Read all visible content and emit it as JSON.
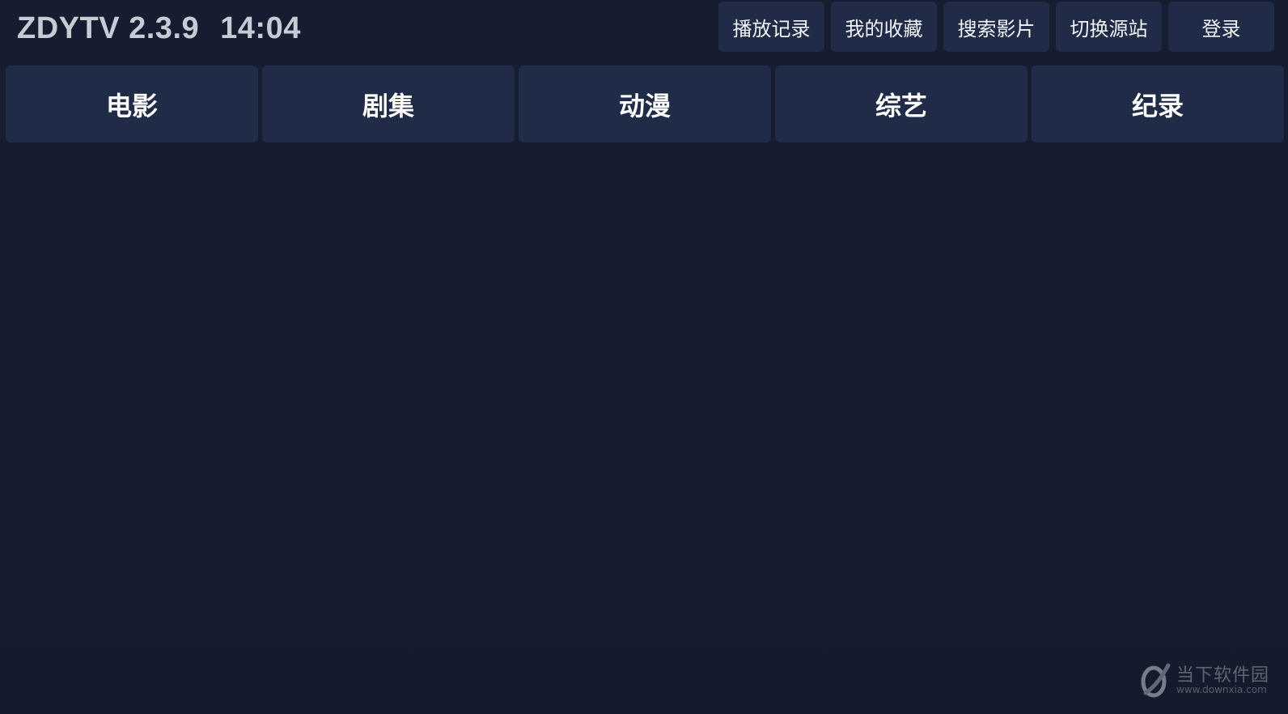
{
  "header": {
    "app_name": "ZDYTV 2.3.9",
    "clock": "14:04"
  },
  "top_actions": [
    {
      "label": "播放记录"
    },
    {
      "label": "我的收藏"
    },
    {
      "label": "搜索影片"
    },
    {
      "label": "切换源站"
    },
    {
      "label": "登录"
    }
  ],
  "category_tabs": [
    {
      "label": "电影"
    },
    {
      "label": "剧集"
    },
    {
      "label": "动漫"
    },
    {
      "label": "综艺"
    },
    {
      "label": "纪录"
    }
  ],
  "watermark": {
    "name": "当下软件园",
    "url": "www.downxia.com",
    "icon": "downxia-logo-icon"
  },
  "colors": {
    "background": "#161d2f",
    "button": "#1f2b47",
    "title_text": "#c7cbd3"
  }
}
